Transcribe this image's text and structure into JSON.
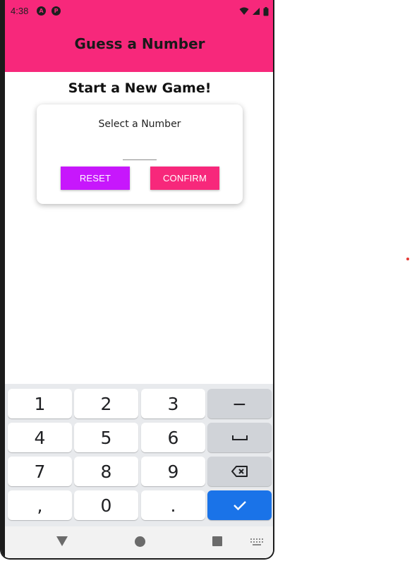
{
  "status_bar": {
    "time": "4:38",
    "app_icons": [
      "A",
      "P"
    ]
  },
  "app_bar": {
    "title": "Guess a Number",
    "background_color": "#f7287b"
  },
  "screen": {
    "title": "Start a New Game!"
  },
  "card": {
    "label": "Select a Number",
    "input_value": "",
    "reset_label": "RESET",
    "reset_color": "#c717fc",
    "confirm_label": "CONFIRM",
    "confirm_color": "#f7287b"
  },
  "keyboard": {
    "rows": [
      [
        "1",
        "2",
        "3",
        "−"
      ],
      [
        "4",
        "5",
        "6",
        "space-icon"
      ],
      [
        "7",
        "8",
        "9",
        "backspace-icon"
      ],
      [
        ",",
        "0",
        ".",
        "checkmark-icon"
      ]
    ],
    "action_color": "#1a73e8"
  },
  "nav_bar": {
    "buttons": [
      "back-triangle-icon",
      "home-circle-icon",
      "recents-square-icon",
      "keyboard-switch-icon"
    ]
  }
}
